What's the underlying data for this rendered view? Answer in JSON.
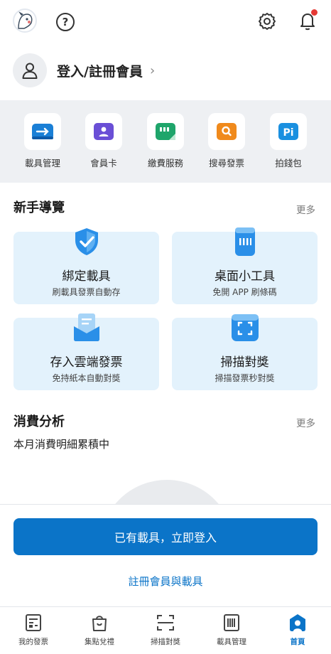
{
  "header": {
    "avatar_icon": "user-avatar-icon",
    "help_icon": "question-circle-icon",
    "help_glyph": "?",
    "settings_icon": "gear-icon",
    "notifications_icon": "bell-icon"
  },
  "login": {
    "label": "登入/註冊會員",
    "chevron": "›"
  },
  "quick_tools": [
    {
      "label": "載具管理",
      "icon": "carrier-card-icon",
      "color": "#1a7fd6"
    },
    {
      "label": "會員卡",
      "icon": "member-card-icon",
      "color": "#6a4fd6"
    },
    {
      "label": "繳費服務",
      "icon": "bill-payment-icon",
      "color": "#1fa56b"
    },
    {
      "label": "搜尋發票",
      "icon": "search-invoice-icon",
      "color": "#f08a1c"
    },
    {
      "label": "拍錢包",
      "icon": "pi-wallet-icon",
      "color": "#1a90e0"
    }
  ],
  "guide": {
    "title": "新手導覽",
    "more": "更多",
    "cards": [
      {
        "title": "綁定載具",
        "subtitle": "刷載具發票自動存",
        "icon": "shield-check-icon"
      },
      {
        "title": "桌面小工具",
        "subtitle": "免開 APP 刷條碼",
        "icon": "barcode-widget-icon"
      },
      {
        "title": "存入雲端發票",
        "subtitle": "免持紙本自動對獎",
        "icon": "cloud-invoice-icon"
      },
      {
        "title": "掃描對獎",
        "subtitle": "掃描發票秒對獎",
        "icon": "scan-frame-icon"
      }
    ]
  },
  "analysis": {
    "title": "消費分析",
    "more": "更多",
    "subtitle": "本月消費明細累積中"
  },
  "actions": {
    "primary": "已有載具，立即登入",
    "secondary": "註冊會員與載具"
  },
  "tabs": [
    {
      "label": "我的發票",
      "icon": "invoice-icon",
      "active": false
    },
    {
      "label": "集點兌禮",
      "icon": "shopping-bag-icon",
      "active": false
    },
    {
      "label": "掃描對獎",
      "icon": "scan-icon",
      "active": false
    },
    {
      "label": "載具管理",
      "icon": "barcode-icon",
      "active": false
    },
    {
      "label": "首頁",
      "icon": "home-icon",
      "active": true
    }
  ],
  "colors": {
    "accent": "#0b74c8",
    "card_bg": "#e3f2fc",
    "tools_bg": "#eef0f3",
    "notification_dot": "#e53935"
  }
}
